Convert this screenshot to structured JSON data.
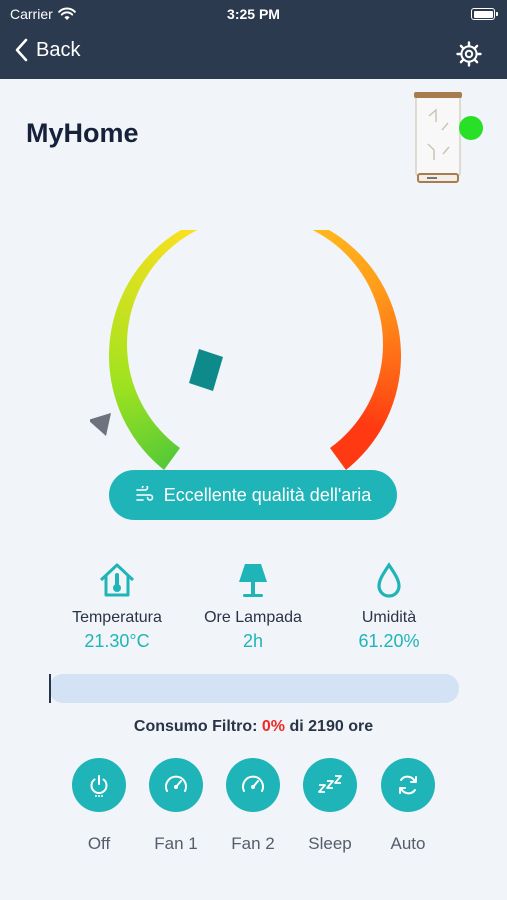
{
  "status": {
    "carrier": "Carrier",
    "time": "3:25 PM"
  },
  "nav": {
    "back_label": "Back"
  },
  "device": {
    "name": "MyHome",
    "online_color": "#27e027"
  },
  "air_quality": {
    "label": "Eccellente qualità dell'aria",
    "level": 0.18
  },
  "metrics": [
    {
      "label": "Temperatura",
      "value": "21.30°C",
      "icon": "thermometer-house-icon"
    },
    {
      "label": "Ore Lampada",
      "value": "2h",
      "icon": "lamp-icon"
    },
    {
      "label": "Umidità",
      "value": "61.20%",
      "icon": "water-drop-icon"
    }
  ],
  "filter": {
    "label": "Consumo Filtro:",
    "percent": "0%",
    "of_text": "di 2190 ore",
    "usage_fraction": 0
  },
  "modes": [
    {
      "label": "Off",
      "icon": "power-icon"
    },
    {
      "label": "Fan 1",
      "icon": "speedometer-icon"
    },
    {
      "label": "Fan 2",
      "icon": "speedometer-icon"
    },
    {
      "label": "Sleep",
      "icon": "sleep-zzz-icon"
    },
    {
      "label": "Auto",
      "icon": "auto-refresh-icon"
    }
  ],
  "colors": {
    "header": "#2c3a4f",
    "accent": "#1fb5b8",
    "warning": "#f02828"
  }
}
